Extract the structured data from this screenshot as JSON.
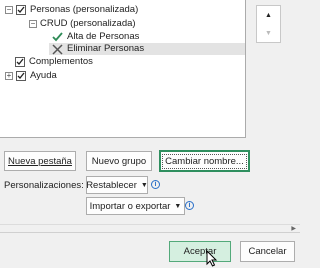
{
  "tree": {
    "items": [
      {
        "label": "Personas (personalizada)",
        "expander": "⊟",
        "checked": true
      },
      {
        "label": "CRUD (personalizada)",
        "expander": "⊟"
      },
      {
        "label": "Alta de Personas",
        "icon": "checkmark-icon"
      },
      {
        "label": "Eliminar Personas",
        "icon": "delete-x-icon",
        "selected": true
      },
      {
        "label": "Complementos",
        "checked": true
      },
      {
        "label": "Ayuda",
        "expander": "⊞",
        "checked": true
      }
    ]
  },
  "move": {
    "up": "▲",
    "down": "▼"
  },
  "buttons": {
    "new_tab": "Nueva pestaña",
    "new_group": "Nuevo grupo",
    "rename": "Cambiar nombre..."
  },
  "customizations": {
    "label": "Personalizaciones:",
    "reset": "Restablecer",
    "import_export": "Importar o exportar",
    "info": "i"
  },
  "footer": {
    "accept": "Aceptar",
    "cancel": "Cancelar"
  },
  "colors": {
    "accept_bg": "#d5efe0",
    "focus_border": "#2f8f5f",
    "check_green": "#2e8b57"
  }
}
